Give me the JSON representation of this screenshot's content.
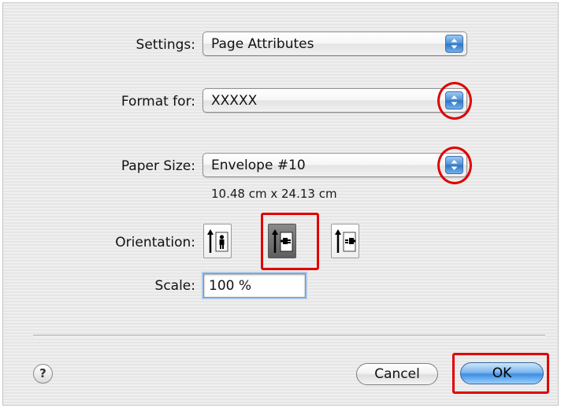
{
  "dialog": {
    "settings": {
      "label": "Settings:",
      "value": "Page Attributes"
    },
    "format_for": {
      "label": "Format for:",
      "value": "XXXXX"
    },
    "paper_size": {
      "label": "Paper Size:",
      "value": "Envelope #10",
      "dimensions": "10.48 cm x 24.13 cm"
    },
    "orientation": {
      "label": "Orientation:",
      "options": [
        "portrait",
        "landscape-left",
        "landscape-right"
      ],
      "selected": "landscape-left"
    },
    "scale": {
      "label": "Scale:",
      "value": "100 %"
    },
    "buttons": {
      "help": "?",
      "cancel": "Cancel",
      "ok": "OK"
    }
  },
  "colors": {
    "highlight": "#e00000",
    "accent": "#3f8ee0"
  }
}
